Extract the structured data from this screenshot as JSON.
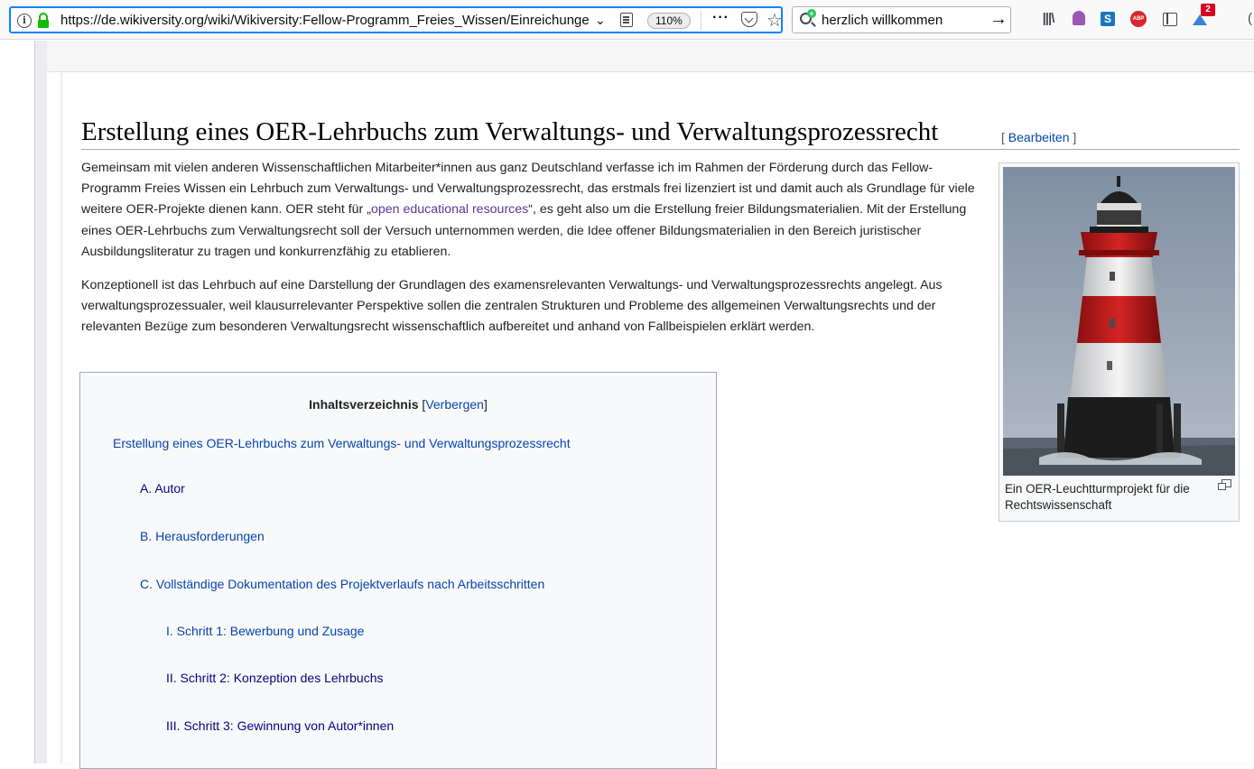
{
  "browser": {
    "url": "https://de.wikiversity.org/wiki/Wikiversity:Fellow-Programm_Freies_Wissen/Einreichunge",
    "zoom": "110%",
    "search_value": "herzlich willkommen",
    "extension_badge": "2",
    "icons": [
      "info-icon",
      "lock-icon",
      "reader-icon",
      "pocket-icon",
      "star-icon",
      "library-icon",
      "ghost-icon",
      "s-icon",
      "abp-icon",
      "sidebar-icon",
      "extension-icon"
    ]
  },
  "article": {
    "heading": "Erstellung eines OER-Lehrbuchs zum Verwaltungs- und Verwaltungsprozessrecht",
    "edit_open": "[ ",
    "edit_label": "Bearbeiten",
    "edit_close": " ]",
    "paragraph1_before": "Gemeinsam mit vielen anderen Wissenschaftlichen Mitarbeiter*innen aus ganz Deutschland verfasse ich im Rahmen der Förderung durch das Fellow-Programm Freies Wissen ein Lehrbuch zum Verwaltungs- und Verwaltungsprozessrecht, das erstmals frei lizenziert ist und damit auch als Grundlage für viele weitere OER-Projekte dienen kann. OER steht für „",
    "paragraph1_link": "open educational resources",
    "paragraph1_after": "“, es geht also um die Erstellung freier Bildungsmaterialien. Mit der Erstellung eines OER-Lehrbuchs zum Verwaltungsrecht soll der Versuch unternommen werden, die Idee offener Bildungsmaterialien in den Bereich juristischer Ausbildungsliteratur zu tragen und konkurrenzfähig zu etablieren.",
    "paragraph2": "Konzeptionell ist das Lehrbuch auf eine Darstellung der Grundlagen des examensrelevanten Verwaltungs- und Verwaltungsprozessrechts angelegt. Aus verwaltungsprozessualer, weil klausurrelevanter Perspektive sollen die zentralen Strukturen und Probleme des allgemeinen Verwaltungsrechts und der relevanten Bezüge zum besonderen Verwaltungsrecht wissenschaftlich aufbereitet und anhand von Fallbeispielen erklärt werden."
  },
  "thumbnail": {
    "caption": "Ein OER-Leuchtturmprojekt für die Rechtswissenschaft"
  },
  "toc": {
    "title": "Inhaltsverzeichnis",
    "toggle_open": " [",
    "toggle_label": "Verbergen",
    "toggle_close": "]",
    "items": [
      "Erstellung eines OER-Lehrbuchs zum Verwaltungs- und Verwaltungsprozessrecht",
      "A. Autor",
      "B. Herausforderungen",
      "C. Vollständige Dokumentation des Projektverlaufs nach Arbeitsschritten",
      "I. Schritt 1: Bewerbung und Zusage",
      "II. Schritt 2: Konzeption des Lehrbuchs",
      "III. Schritt 3: Gewinnung von Autor*innen"
    ]
  }
}
